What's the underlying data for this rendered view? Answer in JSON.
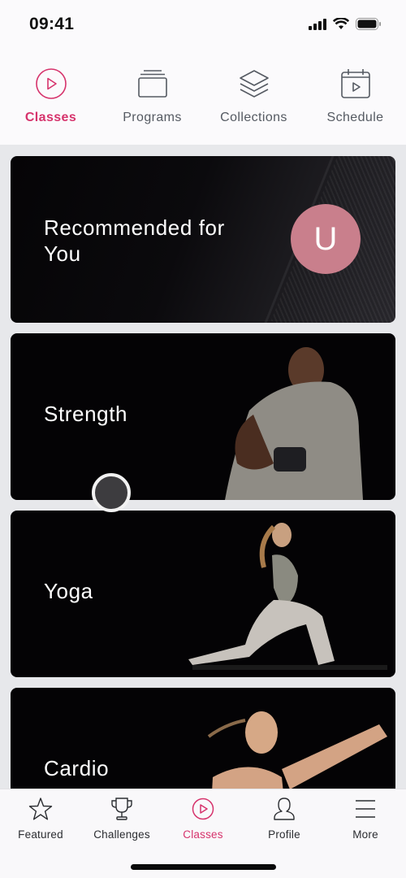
{
  "status_bar": {
    "time": "09:41"
  },
  "top_tabs": [
    {
      "label": "Classes",
      "icon": "play-circle-icon",
      "active": true
    },
    {
      "label": "Programs",
      "icon": "stacked-cards-icon",
      "active": false
    },
    {
      "label": "Collections",
      "icon": "layers-icon",
      "active": false
    },
    {
      "label": "Schedule",
      "icon": "calendar-play-icon",
      "active": false
    }
  ],
  "cards": [
    {
      "title": "Recommended for You",
      "avatar_letter": "U"
    },
    {
      "title": "Strength"
    },
    {
      "title": "Yoga"
    },
    {
      "title": "Cardio"
    }
  ],
  "bottom_nav": [
    {
      "label": "Featured",
      "icon": "star-icon",
      "active": false
    },
    {
      "label": "Challenges",
      "icon": "trophy-icon",
      "active": false
    },
    {
      "label": "Classes",
      "icon": "play-circle-icon",
      "active": true
    },
    {
      "label": "Profile",
      "icon": "person-icon",
      "active": false
    },
    {
      "label": "More",
      "icon": "menu-icon",
      "active": false
    }
  ],
  "colors": {
    "accent": "#d6336c",
    "avatar": "#c97f8c",
    "card_bg": "#040305"
  }
}
